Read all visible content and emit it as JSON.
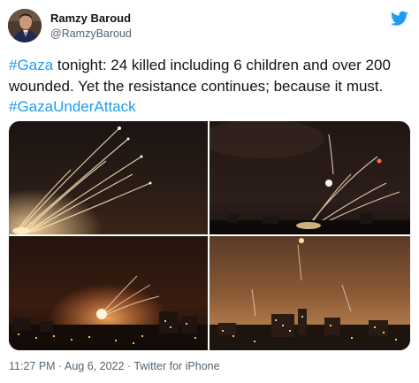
{
  "author": {
    "name": "Ramzy Baroud",
    "handle": "@RamzyBaroud"
  },
  "tweet": {
    "hashtag_1": "#Gaza",
    "text_1": " tonight: 24 killed including 6 children and over 200 wounded. Yet the resistance continues; because it must. ",
    "hashtag_2": "#GazaUnderAttack"
  },
  "media": {
    "photo_count": 4
  },
  "meta": {
    "time": "11:27 PM",
    "separator_1": " · ",
    "date": "Aug 6, 2022",
    "separator_2": " · ",
    "source": "Twitter for iPhone"
  },
  "colors": {
    "link": "#1d9bf0",
    "text": "#0f1419",
    "secondary": "#536471",
    "twitter_brand": "#1d9bf0"
  },
  "icons": {
    "brand": "twitter-bird-icon"
  }
}
